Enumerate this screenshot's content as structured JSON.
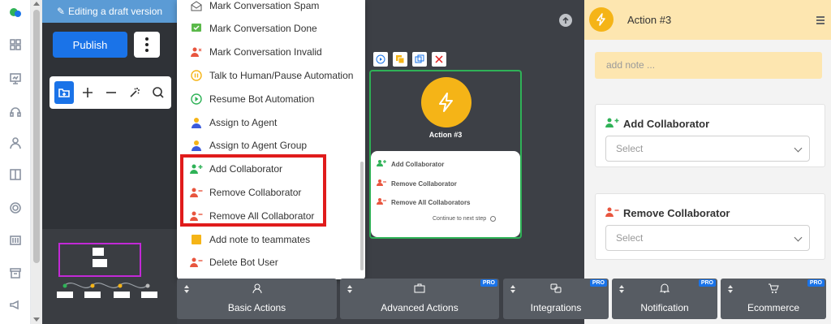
{
  "left_rail": {
    "icons": [
      "chat-bubbles-icon",
      "grid-icon",
      "presentation-icon",
      "headset-icon",
      "user-icon",
      "book-icon",
      "lifebuoy-icon",
      "barcode-icon",
      "archive-icon",
      "megaphone-icon"
    ]
  },
  "left_panel": {
    "draft_label": "Editing a draft version",
    "publish_label": "Publish"
  },
  "menu": {
    "items": [
      {
        "label": "Mark Conversation Spam",
        "icon": "spam-envelope-icon"
      },
      {
        "label": "Mark Conversation Done",
        "icon": "check-message-icon"
      },
      {
        "label": "Mark Conversation Invalid",
        "icon": "user-invalid-icon"
      },
      {
        "label": "Talk to Human/Pause Automation",
        "icon": "pause-circle-icon"
      },
      {
        "label": "Resume Bot Automation",
        "icon": "play-circle-icon"
      },
      {
        "label": "Assign to Agent",
        "icon": "agent-icon"
      },
      {
        "label": "Assign to Agent Group",
        "icon": "agent-group-icon"
      },
      {
        "label": "Add Collaborator",
        "icon": "add-collaborator-icon"
      },
      {
        "label": "Remove Collaborator",
        "icon": "remove-collaborator-icon"
      },
      {
        "label": "Remove All Collaborator",
        "icon": "remove-all-collaborator-icon"
      },
      {
        "label": "Add note to teammates",
        "icon": "sticky-note-icon"
      },
      {
        "label": "Delete Bot User",
        "icon": "delete-user-icon"
      }
    ]
  },
  "node": {
    "title": "Action #3",
    "rows": [
      "Add Collaborator",
      "Remove Collaborator",
      "Remove All Collaborators"
    ],
    "continue_label": "Continue to next step"
  },
  "right_panel": {
    "title": "Action #3",
    "note_placeholder": "add note ...",
    "add_collaborator": {
      "label": "Add Collaborator",
      "select": "Select"
    },
    "remove_collaborator": {
      "label": "Remove Collaborator",
      "select": "Select"
    }
  },
  "tabs": [
    {
      "label": "Basic Actions",
      "pro": ""
    },
    {
      "label": "Advanced Actions",
      "pro": "PRO"
    },
    {
      "label": "Integrations",
      "pro": "PRO"
    },
    {
      "label": "Notification",
      "pro": "PRO"
    },
    {
      "label": "Ecommerce",
      "pro": "PRO"
    }
  ],
  "colors": {
    "accent": "#1a73e8",
    "action_yellow": "#f5b417",
    "node_border": "#2fb257",
    "highlight_red": "#e01b1b",
    "note_bg": "#fde6b0"
  }
}
